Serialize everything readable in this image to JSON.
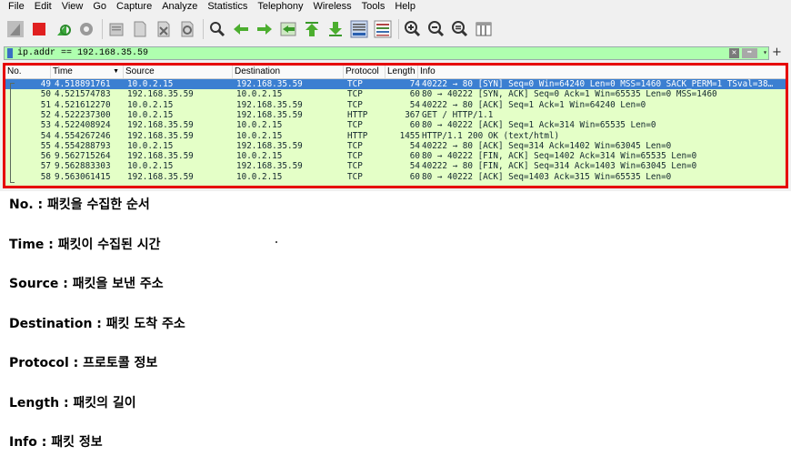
{
  "menu": [
    "File",
    "Edit",
    "View",
    "Go",
    "Capture",
    "Analyze",
    "Statistics",
    "Telephony",
    "Wireless",
    "Tools",
    "Help"
  ],
  "filter": {
    "value": "ip.addr == 192.168.35.59",
    "clear_glyph": "✕",
    "apply_glyph": "➡",
    "dropdown_glyph": "▾",
    "add_glyph": "+"
  },
  "columns": {
    "no": "No.",
    "time": "Time",
    "source": "Source",
    "destination": "Destination",
    "protocol": "Protocol",
    "length": "Length",
    "info": "Info"
  },
  "packets": [
    {
      "no": "49",
      "time": "4.518891761",
      "src": "10.0.2.15",
      "dst": "192.168.35.59",
      "proto": "TCP",
      "len": "74",
      "info": "40222 → 80 [SYN] Seq=0 Win=64240 Len=0 MSS=1460 SACK_PERM=1 TSval=38…",
      "selected": true
    },
    {
      "no": "50",
      "time": "4.521574783",
      "src": "192.168.35.59",
      "dst": "10.0.2.15",
      "proto": "TCP",
      "len": "60",
      "info": "80 → 40222 [SYN, ACK] Seq=0 Ack=1 Win=65535 Len=0 MSS=1460"
    },
    {
      "no": "51",
      "time": "4.521612270",
      "src": "10.0.2.15",
      "dst": "192.168.35.59",
      "proto": "TCP",
      "len": "54",
      "info": "40222 → 80 [ACK] Seq=1 Ack=1 Win=64240 Len=0"
    },
    {
      "no": "52",
      "time": "4.522237300",
      "src": "10.0.2.15",
      "dst": "192.168.35.59",
      "proto": "HTTP",
      "len": "367",
      "info": "GET / HTTP/1.1"
    },
    {
      "no": "53",
      "time": "4.522408924",
      "src": "192.168.35.59",
      "dst": "10.0.2.15",
      "proto": "TCP",
      "len": "60",
      "info": "80 → 40222 [ACK] Seq=1 Ack=314 Win=65535 Len=0"
    },
    {
      "no": "54",
      "time": "4.554267246",
      "src": "192.168.35.59",
      "dst": "10.0.2.15",
      "proto": "HTTP",
      "len": "1455",
      "info": "HTTP/1.1 200 OK  (text/html)"
    },
    {
      "no": "55",
      "time": "4.554288793",
      "src": "10.0.2.15",
      "dst": "192.168.35.59",
      "proto": "TCP",
      "len": "54",
      "info": "40222 → 80 [ACK] Seq=314 Ack=1402 Win=63045 Len=0"
    },
    {
      "no": "56",
      "time": "9.562715264",
      "src": "192.168.35.59",
      "dst": "10.0.2.15",
      "proto": "TCP",
      "len": "60",
      "info": "80 → 40222 [FIN, ACK] Seq=1402 Ack=314 Win=65535 Len=0"
    },
    {
      "no": "57",
      "time": "9.562883303",
      "src": "10.0.2.15",
      "dst": "192.168.35.59",
      "proto": "TCP",
      "len": "54",
      "info": "40222 → 80 [FIN, ACK] Seq=314 Ack=1403 Win=63045 Len=0"
    },
    {
      "no": "58",
      "time": "9.563061415",
      "src": "192.168.35.59",
      "dst": "10.0.2.15",
      "proto": "TCP",
      "len": "60",
      "info": "80 → 40222 [ACK] Seq=1403 Ack=315 Win=65535 Len=0"
    }
  ],
  "legend": [
    "No. : 패킷을 수집한 순서",
    "Time : 패킷이 수집된 시간",
    "Source : 패킷을 보낸 주소",
    "Destination : 패킷 도착 주소",
    "Protocol : 프로토콜 정보",
    "Length : 패킷의 길이",
    "Info : 패킷 정보"
  ],
  "colors": {
    "selected_row": "#3b7fd1",
    "row_bg": "#e4ffc7",
    "filter_bg": "#afffaf",
    "highlight_border": "#e60000"
  },
  "toolbar_icons": [
    "shark-fin-start-icon",
    "stop-icon",
    "restart-icon",
    "options-gear-icon",
    "open-folder-icon",
    "save-file-icon",
    "close-file-icon",
    "reload-icon",
    "find-icon",
    "back-arrow-icon",
    "forward-arrow-icon",
    "go-to-packet-icon",
    "first-packet-icon",
    "last-packet-icon",
    "auto-scroll-icon",
    "colorize-icon",
    "zoom-in-icon",
    "zoom-out-icon",
    "zoom-reset-icon",
    "resize-columns-icon"
  ]
}
